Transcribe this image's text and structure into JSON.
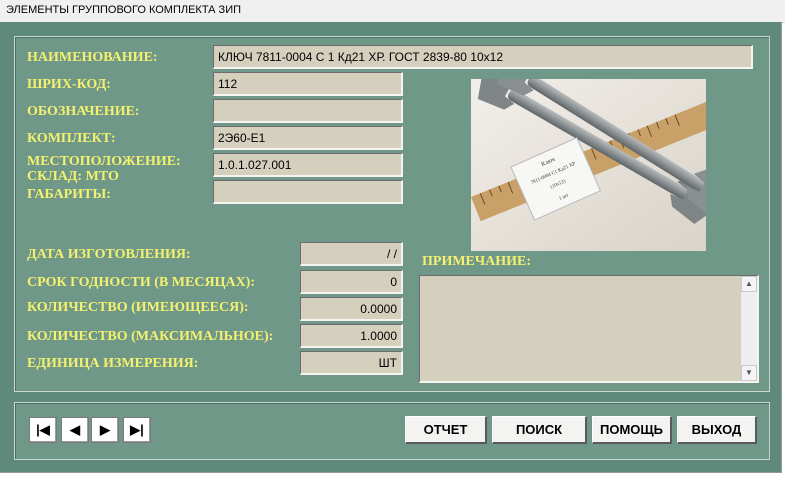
{
  "window": {
    "title": "ЭЛЕМЕНТЫ ГРУППОВОГО КОМПЛЕКТА ЗИП"
  },
  "form": {
    "name_label": "НАИМЕНОВАНИЕ:",
    "name_value": "КЛЮЧ 7811-0004 С 1 Кд21 ХР. ГОСТ 2839-80 10х12",
    "barcode_label": "ШРИХ-КОД:",
    "barcode_value": "112",
    "designation_label": "ОБОЗНАЧЕНИЕ:",
    "designation_value": "",
    "kit_label": "КОМПЛЕКТ:",
    "kit_value": "2Э60-Е1",
    "location_label": "МЕСТОПОЛОЖЕНИЕ:",
    "location_value": "1.0.1.027.001",
    "warehouse_label": "СКЛАД: МТО",
    "warehouse_value": "",
    "dimensions_label": "ГАБАРИТЫ:",
    "manufacture_date_label": "ДАТА ИЗГОТОВЛЕНИЯ:",
    "manufacture_date_value": "/ /",
    "shelf_life_label": "СРОК ГОДНОСТИ (В МЕСЯЦАХ):",
    "shelf_life_value": "0",
    "qty_current_label": "КОЛИЧЕСТВО (ИМЕЮЩЕЕСЯ):",
    "qty_current_value": "0.0000",
    "qty_max_label": "КОЛИЧЕСТВО (МАКСИМАЛЬНОЕ):",
    "qty_max_value": "1.0000",
    "unit_label": "ЕДИНИЦА ИЗМЕРЕНИЯ:",
    "unit_value": "ШТ",
    "note_label": "ПРИМЕЧАНИЕ:",
    "note_value": ""
  },
  "photo": {
    "tag_line1": "Ключ",
    "tag_line2": "7811-0004 С1 Кд21 ХР",
    "tag_line3": "(10х12)",
    "tag_line4": "1 шт"
  },
  "nav": {
    "first_icon": "first-record-icon",
    "prev_icon": "previous-record-icon",
    "next_icon": "next-record-icon",
    "last_icon": "last-record-icon"
  },
  "buttons": {
    "report": "ОТЧЕТ",
    "search": "ПОИСК",
    "help": "ПОМОЩЬ",
    "exit": "ВЫХОД"
  },
  "colors": {
    "background": "#5f8a7b",
    "label": "#f4f170",
    "field": "#d5cfbd"
  }
}
